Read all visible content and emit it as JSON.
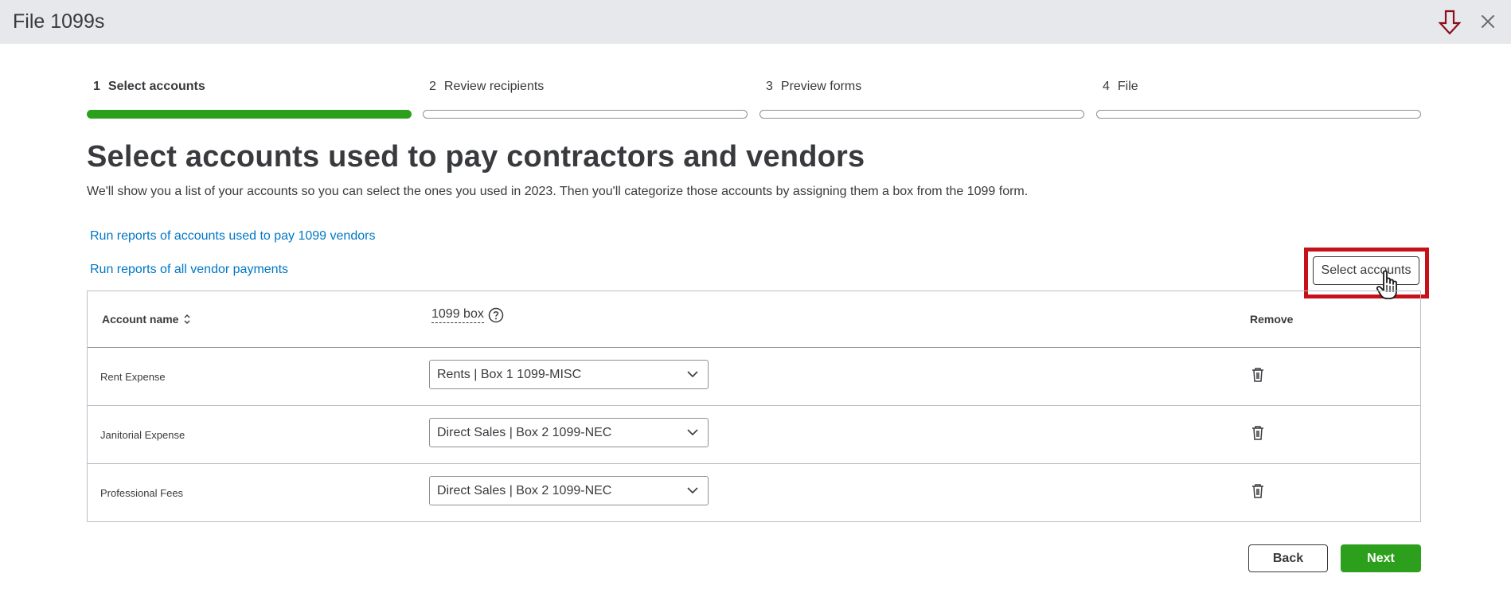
{
  "window": {
    "title": "File 1099s"
  },
  "stepper": {
    "steps": [
      {
        "number": "1",
        "label": "Select accounts",
        "active": true
      },
      {
        "number": "2",
        "label": "Review recipients",
        "active": false
      },
      {
        "number": "3",
        "label": "Preview forms",
        "active": false
      },
      {
        "number": "4",
        "label": "File",
        "active": false
      }
    ]
  },
  "main": {
    "heading": "Select accounts used to pay contractors and vendors",
    "subtext": "We'll show you a list of your accounts so you can select the ones you used in 2023. Then you'll categorize those accounts by assigning them a box from the 1099 form.",
    "links": {
      "run_reports_1099": "Run reports of accounts used to pay 1099 vendors",
      "run_reports_all": "Run reports of all vendor payments"
    },
    "select_accounts_button": "Select accounts"
  },
  "table": {
    "headers": {
      "account_name": "Account name",
      "box_1099": "1099 box",
      "remove": "Remove"
    },
    "rows": [
      {
        "account": "Rent Expense",
        "box": "Rents |  Box 1 1099-MISC"
      },
      {
        "account": "Janitorial Expense",
        "box": "Direct Sales |  Box 2 1099-NEC"
      },
      {
        "account": "Professional Fees",
        "box": "Direct Sales |  Box 2 1099-NEC"
      }
    ]
  },
  "footer": {
    "back": "Back",
    "next": "Next"
  },
  "colors": {
    "accent_green": "#2ca01c",
    "link_blue": "#0077c5",
    "highlight_red": "#c6101a",
    "download_icon": "#8b0f1a"
  }
}
